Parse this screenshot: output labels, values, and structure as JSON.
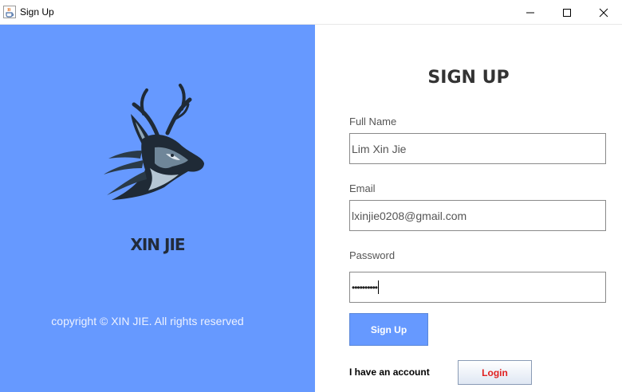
{
  "window": {
    "title": "Sign Up",
    "icon": "java-cup-icon"
  },
  "brand": {
    "name": "XIN JIE",
    "logo": "deer-head-logo",
    "copyright": "copyright © XIN JIE. All rights reserved"
  },
  "form": {
    "heading": "SIGN UP",
    "full_name": {
      "label": "Full Name",
      "value": "Lim Xin Jie"
    },
    "email": {
      "label": "Email",
      "value": "lxinjie0208@gmail.com"
    },
    "password": {
      "label": "Password",
      "value": "••••••••••"
    },
    "signup_label": "Sign Up",
    "account_text": "I have an account",
    "login_label": "Login"
  },
  "colors": {
    "left_panel": "#6699ff",
    "signup_button": "#6699ff",
    "login_text": "#e02020"
  }
}
